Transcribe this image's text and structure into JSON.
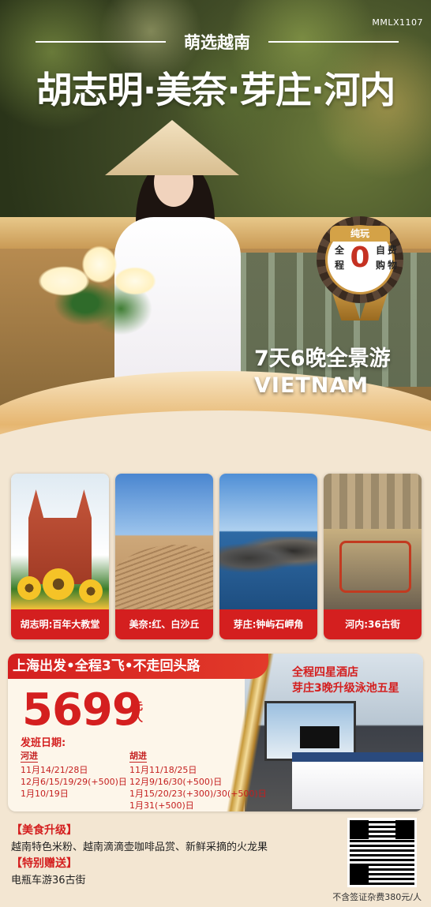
{
  "code": "MMLX1107",
  "subtitle": "萌选越南",
  "title": "胡志明·美奈·芽庄·河内",
  "badge": {
    "top": "纯玩",
    "chars": [
      "全",
      "程",
      "自",
      "费",
      "购",
      "物"
    ],
    "zero": "0"
  },
  "promo": {
    "line1": "7天6晚全景游",
    "line2": "VIETNAM"
  },
  "cards": [
    {
      "caption": "胡志明:百年大教堂"
    },
    {
      "caption": "美奈:红、白沙丘"
    },
    {
      "caption": "芽庄:钟屿石岬角"
    },
    {
      "caption": "河内:36古街"
    }
  ],
  "route_bar": "上海出发•全程3飞•不走回头路",
  "price": "5699",
  "price_unit": [
    "元",
    "人"
  ],
  "dates_heading": "发班日期:",
  "dates_left": {
    "tag": "河进",
    "rows": [
      "11月14/21/28日",
      "12月6/15/19/29(+500)日",
      "1月10/19日"
    ]
  },
  "dates_right": {
    "tag": "胡进",
    "rows": [
      "11月11/18/25日",
      "12月9/16/30(+500)日",
      "1月15/20/23(+300)/30(+500)日",
      "1月31(+500)日"
    ]
  },
  "hotel": {
    "line1": "全程四星酒店",
    "line2": "芽庄3晚升级泳池五星"
  },
  "extras": {
    "food_heading": "【美食升级】",
    "food_text": "越南特色米粉、越南滴滴壶咖啡品赏、新鲜采摘的火龙果",
    "gift_heading": "【特别赠送】",
    "gift_text": "电瓶车游36古街"
  },
  "note": "不含签证杂费380元/人"
}
